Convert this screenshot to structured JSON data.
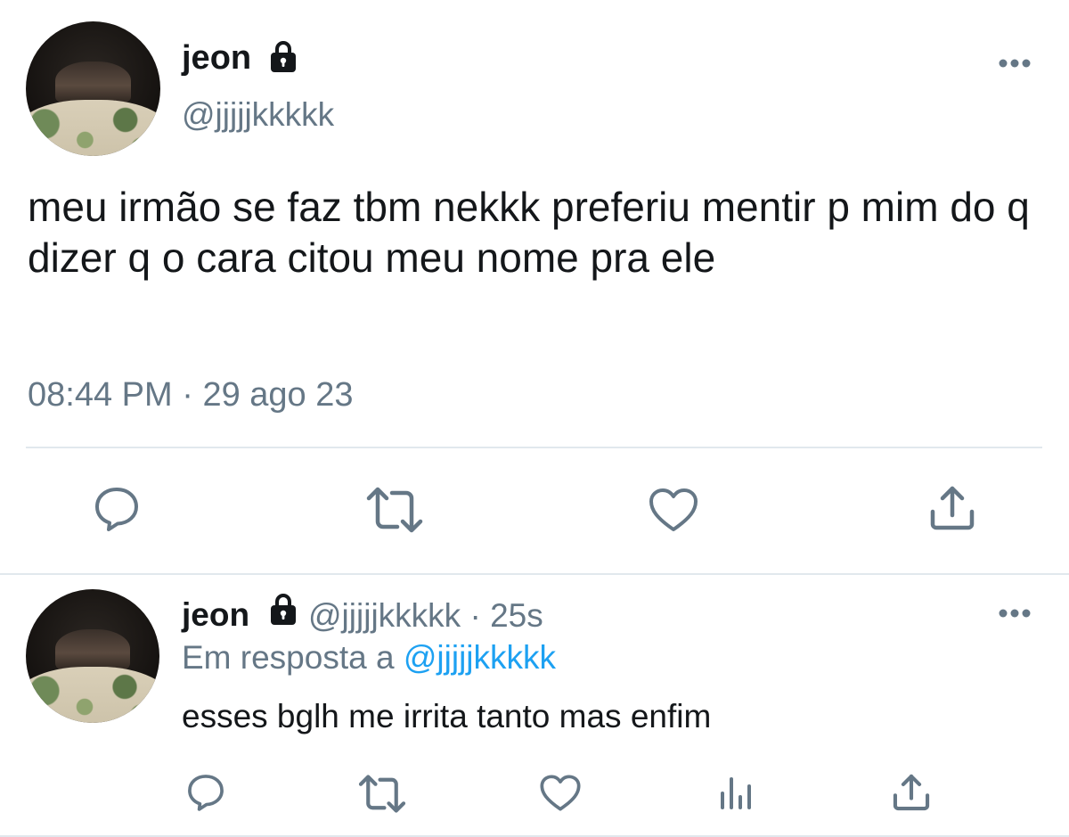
{
  "main_tweet": {
    "display_name": "jeon",
    "handle": "@jjjjjkkkkk",
    "text": "meu irmão se faz tbm nekkk preferiu mentir p mim do q dizer q o cara citou meu nome pra ele",
    "time": "08:44 PM",
    "separator": "·",
    "date": "29 ago 23",
    "protected_icon": "lock-icon",
    "actions": [
      "reply-icon",
      "retweet-icon",
      "like-icon",
      "share-icon"
    ]
  },
  "reply_tweet": {
    "display_name": "jeon",
    "handle": "@jjjjjkkkkk",
    "separator": "·",
    "time": "25s",
    "replying_to_label": "Em resposta a",
    "replying_to_handle": "@jjjjjkkkkk",
    "text": "esses bglh me irrita tanto mas enfim",
    "protected_icon": "lock-icon",
    "actions": [
      "reply-icon",
      "retweet-icon",
      "like-icon",
      "analytics-icon",
      "share-icon"
    ]
  },
  "colors": {
    "text_primary": "#14171a",
    "text_secondary": "#657786",
    "link": "#1da1f2",
    "divider": "#e1e8ed"
  }
}
